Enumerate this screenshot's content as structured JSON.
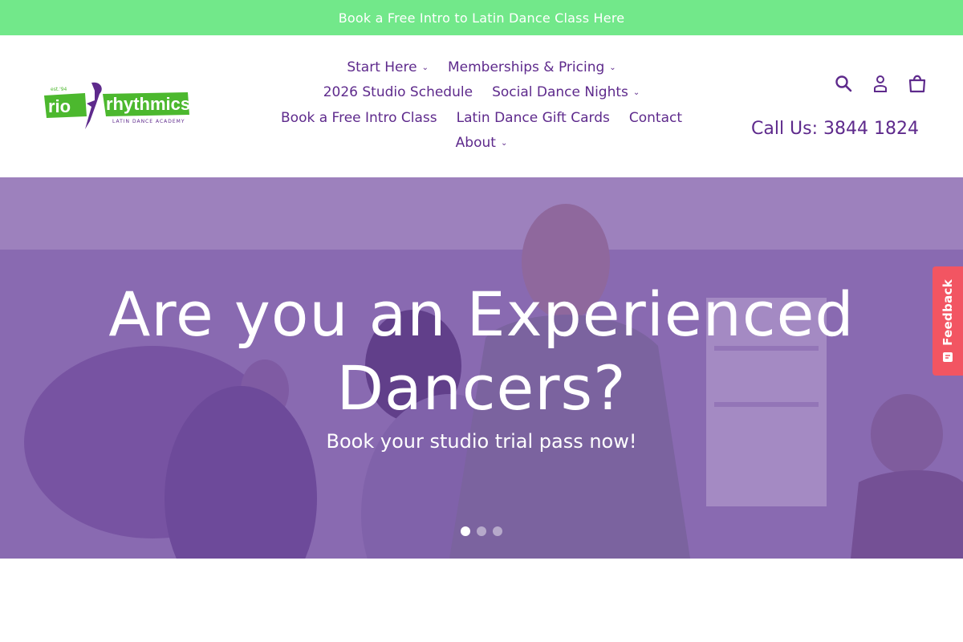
{
  "announcement": {
    "text": "Book a Free Intro to Latin Dance Class Here"
  },
  "logo": {
    "est": "est.'94",
    "word1": "rio",
    "word2": "rhythmics",
    "tagline": "LATIN DANCE ACADEMY"
  },
  "nav": {
    "rows": [
      [
        {
          "label": "Start Here",
          "dropdown": true
        },
        {
          "label": "Memberships & Pricing",
          "dropdown": true
        }
      ],
      [
        {
          "label": "2026 Studio Schedule",
          "dropdown": false
        },
        {
          "label": "Social Dance Nights",
          "dropdown": true
        }
      ],
      [
        {
          "label": "Book a Free Intro Class",
          "dropdown": false
        },
        {
          "label": "Latin Dance Gift Cards",
          "dropdown": false
        },
        {
          "label": "Contact",
          "dropdown": false
        }
      ],
      [
        {
          "label": "About",
          "dropdown": true
        }
      ]
    ]
  },
  "header_icons": [
    "search-icon",
    "account-icon",
    "cart-icon"
  ],
  "phone": {
    "text": "Call Us: 3844 1824"
  },
  "hero": {
    "title_line1": "Are you an Experienced",
    "title_line2": "Dancers?",
    "subtitle": "Book your studio trial pass now!",
    "slides": 3,
    "active_slide": 1
  },
  "feedback": {
    "label": "Feedback"
  },
  "colors": {
    "brand_purple": "#5e2a8c",
    "announcement_green": "#72e88a",
    "feedback_red": "#f25562",
    "logo_green": "#4cb82e"
  }
}
